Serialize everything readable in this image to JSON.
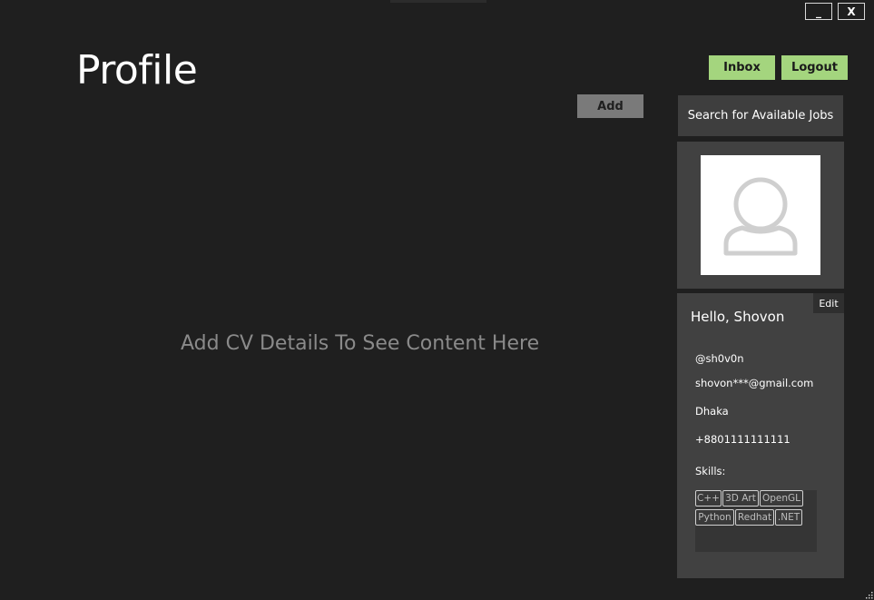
{
  "window": {
    "minimize_label": "_",
    "close_label": "X"
  },
  "page": {
    "title": "Profile",
    "empty_message": "Add CV Details To See Content Here",
    "add_label": "Add"
  },
  "nav": {
    "inbox_label": "Inbox",
    "logout_label": "Logout"
  },
  "sidebar": {
    "search_jobs_label": "Search for Available Jobs",
    "avatar_icon": "user-avatar-icon",
    "edit_label": "Edit",
    "greeting": "Hello, Shovon",
    "username": "@sh0v0n",
    "email": "shovon***@gmail.com",
    "location": "Dhaka",
    "phone": "+8801111111111",
    "skills_label": "Skills:",
    "skills": [
      "C++",
      "3D Art",
      "OpenGL",
      "Python",
      "Redhat",
      ".NET"
    ]
  },
  "colors": {
    "background": "#1f1f1f",
    "panel": "#414141",
    "accent_green": "#a4d57e",
    "muted_text": "#8a8a8a"
  }
}
